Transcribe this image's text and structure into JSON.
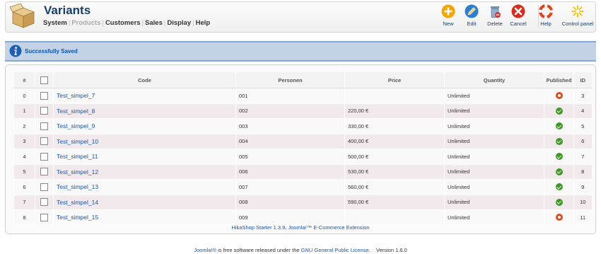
{
  "header": {
    "title": "Variants",
    "menu": [
      {
        "label": "System",
        "disabled": false
      },
      {
        "label": "Products",
        "disabled": true
      },
      {
        "label": "Customers",
        "disabled": false
      },
      {
        "label": "Sales",
        "disabled": false
      },
      {
        "label": "Display",
        "disabled": false
      },
      {
        "label": "Help",
        "disabled": false
      }
    ],
    "menu_separator": "|"
  },
  "toolbar": {
    "new": "New",
    "edit": "Edit",
    "delete": "Delete",
    "cancel": "Cancel",
    "help": "Help",
    "control_panel": "Control panel"
  },
  "message": {
    "text": "Successfully Saved"
  },
  "table": {
    "columns": {
      "num": "#",
      "code": "Code",
      "personen": "Personen",
      "price": "Price",
      "quantity": "Quantity",
      "published": "Published",
      "id": "ID"
    },
    "rows": [
      {
        "num": "0",
        "code": "Test_simpel_7",
        "personen": "001",
        "price": "",
        "quantity": "Unlimited",
        "published": false,
        "id": "3"
      },
      {
        "num": "1",
        "code": "Test_simpel_8",
        "personen": "002",
        "price": "220,00 €",
        "quantity": "Unlimited",
        "published": true,
        "id": "4"
      },
      {
        "num": "2",
        "code": "Test_simpel_9",
        "personen": "003",
        "price": "330,00 €",
        "quantity": "Unlimited",
        "published": true,
        "id": "5"
      },
      {
        "num": "3",
        "code": "Test_simpel_10",
        "personen": "004",
        "price": "400,00 €",
        "quantity": "Unlimited",
        "published": true,
        "id": "6"
      },
      {
        "num": "4",
        "code": "Test_simpel_11",
        "personen": "005",
        "price": "500,00 €",
        "quantity": "Unlimited",
        "published": true,
        "id": "7"
      },
      {
        "num": "5",
        "code": "Test_simpel_12",
        "personen": "006",
        "price": "530,00 €",
        "quantity": "Unlimited",
        "published": true,
        "id": "8"
      },
      {
        "num": "6",
        "code": "Test_simpel_13",
        "personen": "007",
        "price": "560,00 €",
        "quantity": "Unlimited",
        "published": true,
        "id": "9"
      },
      {
        "num": "7",
        "code": "Test_simpel_14",
        "personen": "008",
        "price": "590,00 €",
        "quantity": "Unlimited",
        "published": true,
        "id": "10"
      },
      {
        "num": "8",
        "code": "Test_simpel_15",
        "personen": "009",
        "price": "",
        "quantity": "Unlimited",
        "published": false,
        "id": "11"
      }
    ]
  },
  "extension_footer": "HikaShop Starter 1.3.9, Joomla!™ E-Commerce Extension",
  "credit": {
    "joomla_link": "Joomla!®",
    "text_middle": " is free software released under the ",
    "license_link": "GNU General Public License",
    "version": ".    Version 1.6.0"
  },
  "colors": {
    "title": "#15406d",
    "link": "#1b57b1",
    "message_bg": "#c3d2e5",
    "message_border": "#84a7db",
    "row_alt": "#f1e9ec",
    "published_yes": "#3a9a1f",
    "published_no": "#d94d1e"
  },
  "icons": {
    "page": "box-icon",
    "new": "plus-circle-icon",
    "edit": "pencil-icon",
    "delete": "trash-icon",
    "cancel": "x-circle-icon",
    "help": "lifebuoy-icon",
    "control_panel": "star-burst-icon",
    "message": "info-icon"
  }
}
